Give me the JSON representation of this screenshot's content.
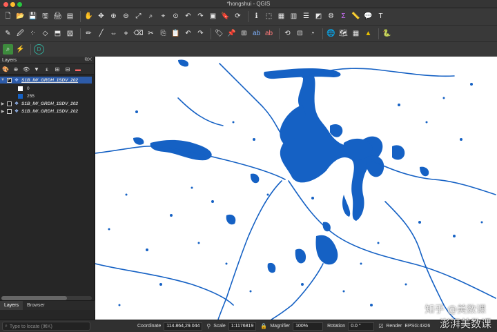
{
  "window": {
    "title": "*hongshui - QGIS"
  },
  "layers_panel": {
    "title": "Layers",
    "layers": [
      {
        "name": "S1B_IW_GRDH_1SDV_202",
        "checked": true,
        "expanded": true,
        "selected": true
      },
      {
        "name": "S1B_IW_GRDH_1SDV_202",
        "checked": false,
        "expanded": false,
        "selected": false
      },
      {
        "name": "S1B_IW_GRDH_1SDV_202",
        "checked": false,
        "expanded": false,
        "selected": false
      }
    ],
    "legend": [
      {
        "label": "0",
        "color": "#ffffff"
      },
      {
        "label": "255",
        "color": "#1561c4"
      }
    ]
  },
  "bottom_tabs": [
    {
      "label": "Layers",
      "active": true
    },
    {
      "label": "Browser",
      "active": false
    }
  ],
  "status_bar": {
    "locate_placeholder": "Type to locate (⌘K)",
    "coordinate_label": "Coordinate",
    "coordinate_value": "114.864,29.044",
    "scale_label": "Scale",
    "scale_value": "1:1176819",
    "magnifier_label": "Magnifier",
    "magnifier_value": "100%",
    "rotation_label": "Rotation",
    "rotation_value": "0.0 °",
    "render_label": "Render",
    "crs_label": "EPSG:4326"
  },
  "watermarks": {
    "top": "知乎 @美数课",
    "bottom": "澎湃美数课"
  },
  "colors": {
    "water": "#1561c4",
    "selection": "#2d5ba8"
  }
}
